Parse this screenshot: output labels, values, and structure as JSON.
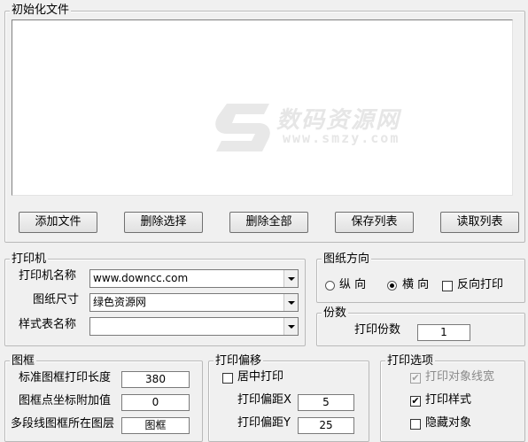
{
  "init_files": {
    "legend": "初始化文件",
    "watermark": {
      "text": "数码资源网",
      "url": "www.smzy.com"
    },
    "buttons": [
      "添加文件",
      "删除选择",
      "删除全部",
      "保存列表",
      "读取列表"
    ]
  },
  "printer": {
    "legend": "打印机",
    "name_label": "打印机名称",
    "name_value": "www.downcc.com",
    "paper_label": "图纸尺寸",
    "paper_value": "绿色资源网",
    "style_label": "样式表名称",
    "style_value": ""
  },
  "orientation": {
    "legend": "图纸方向",
    "portrait": "纵 向",
    "landscape": "横 向",
    "reverse": "反向打印",
    "selected": "landscape",
    "reverse_checked": false
  },
  "copies": {
    "legend": "份数",
    "label": "打印份数",
    "value": "1"
  },
  "frame": {
    "legend": "图框",
    "length_label": "标准图框打印长度",
    "length_value": "380",
    "coord_label": "图框点坐标附加值",
    "coord_value": "0",
    "layer_label": "多段线图框所在图层",
    "layer_value": "图框"
  },
  "offset": {
    "legend": "打印偏移",
    "center_label": "居中打印",
    "center_checked": false,
    "x_label": "打印偏距X",
    "x_value": "5",
    "y_label": "打印偏距Y",
    "y_value": "25"
  },
  "options": {
    "legend": "打印选项",
    "line_width_label": "打印对象线宽",
    "line_width_checked": true,
    "line_width_disabled": true,
    "style_label": "打印样式",
    "style_checked": true,
    "hidden_label": "隐藏对象",
    "hidden_checked": false
  }
}
